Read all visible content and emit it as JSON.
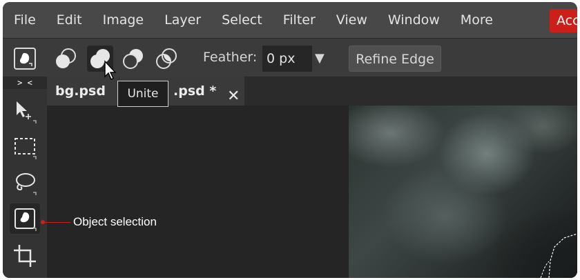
{
  "menubar": {
    "items": [
      "File",
      "Edit",
      "Image",
      "Layer",
      "Select",
      "Filter",
      "View",
      "Window",
      "More"
    ],
    "account_label": "Acc"
  },
  "options": {
    "feather_label": "Feather:",
    "feather_value": "0 px",
    "dropdown_arrow": "▼",
    "refine_edge_label": "Refine Edge"
  },
  "tools": {
    "collapse_label": "> <"
  },
  "tabs": {
    "first": "bg.psd",
    "second": ".psd *",
    "close_glyph": "✕"
  },
  "tooltip": {
    "text": "Unite"
  },
  "annotation": {
    "text": "Object selection",
    "color": "#cc1f1a"
  },
  "colors": {
    "menubar_bg": "#484848",
    "optionsbar_bg": "#3b3b3b",
    "panel_bg": "#333333",
    "accent_red": "#cc1f1a"
  }
}
